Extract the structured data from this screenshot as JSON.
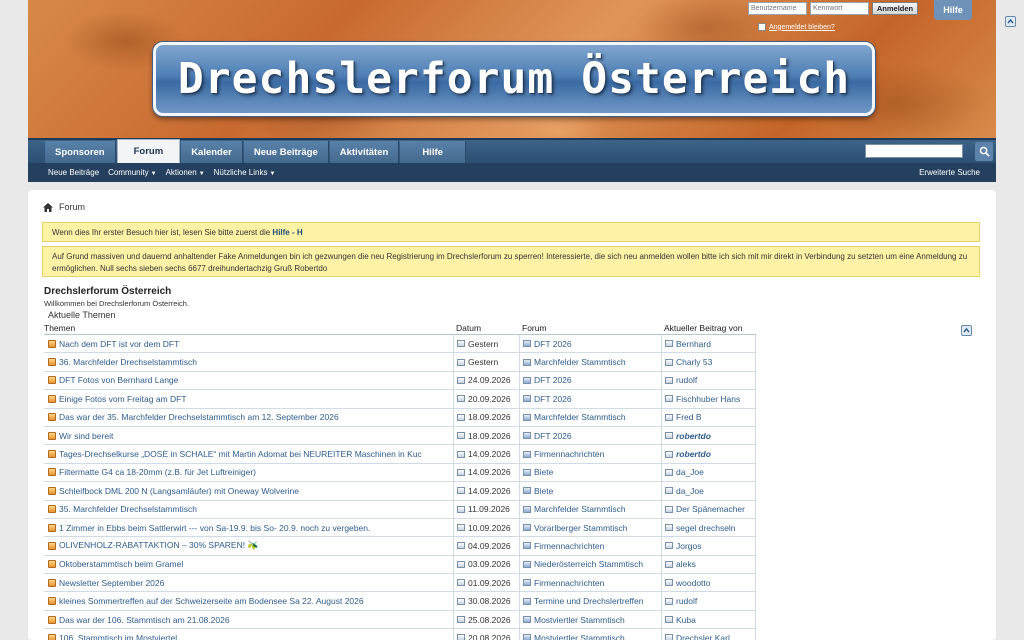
{
  "header": {
    "logo_text": "Drechslerforum Österreich",
    "username_placeholder": "Benutzername",
    "password_placeholder": "Kennwort",
    "login_label": "Anmelden",
    "help_label": "Hilfe",
    "remember_label": "Angemeldet bleiben?"
  },
  "nav": {
    "tabs": [
      "Sponsoren",
      "Forum",
      "Kalender",
      "Neue Beiträge",
      "Aktivitäten",
      "Hilfe"
    ],
    "active_tab": "Forum",
    "sub_items": [
      "Neue Beiträge",
      "Community",
      "Aktionen",
      "Nützliche Links"
    ],
    "advanced_search": "Erweiterte Suche"
  },
  "breadcrumb": {
    "label": "Forum"
  },
  "notices": {
    "first_visit_text": "Wenn dies Ihr erster Besuch hier ist, lesen Sie bitte zuerst die",
    "first_visit_link": "Hilfe - H",
    "registration_text": "Auf Grund massiven und dauernd anhaltender Fake Anmeldungen bin ich gezwungen die neu Registrierung im Drechslerforum zu sperren! Interessierte, die sich neu anmelden wollen bitte ich sich mit mir direkt in Verbindung zu setzten um eine Anmeldung zu ermöglichen. Null sechs sieben sechs 6677 dreihundertachzig Gruß Robertdo"
  },
  "forum": {
    "title": "Drechslerforum Österreich",
    "subtitle": "Willkommen bei Drechslerforum Österreich.",
    "topics_label": "Aktuelle Themen"
  },
  "threads": {
    "headers": {
      "topic": "Themen",
      "date": "Datum",
      "forum": "Forum",
      "last_post": "Aktueller Beitrag von"
    },
    "rows": [
      {
        "topic": "Nach dem DFT ist vor dem DFT",
        "date": "Gestern",
        "forum": "DFT 2026",
        "user": "Bernhard",
        "emph": false
      },
      {
        "topic": "36. Marchfelder Drechselstammtisch",
        "date": "Gestern",
        "forum": "Marchfelder Stammtisch",
        "user": "Charly 53",
        "emph": false
      },
      {
        "topic": "DFT Fotos von Bernhard Lange",
        "date": "24.09.2026",
        "forum": "DFT 2026",
        "user": "rudolf",
        "emph": false
      },
      {
        "topic": "Einige Fotos vom Freitag am DFT",
        "date": "20.09.2026",
        "forum": "DFT 2026",
        "user": "Fischhuber Hans",
        "emph": false
      },
      {
        "topic": "Das war der 35. Marchfelder Drechselstammtisch am 12. September 2026",
        "date": "18.09.2026",
        "forum": "Marchfelder Stammtisch",
        "user": "Fred B",
        "emph": false
      },
      {
        "topic": "Wir sind bereit",
        "date": "18.09.2026",
        "forum": "DFT 2026",
        "user": "robertdo",
        "emph": true
      },
      {
        "topic": "Tages-Drechselkurse „DOSE in SCHALE“ mit Martin Adomat bei NEUREITER Maschinen in Kuc",
        "date": "14.09.2026",
        "forum": "Firmennachrichten",
        "user": "robertdo",
        "emph": true
      },
      {
        "topic": "Filtermatte G4 ca 18-20mm (z.B. für Jet Luftreiniger)",
        "date": "14.09.2026",
        "forum": "Biete",
        "user": "da_Joe",
        "emph": false
      },
      {
        "topic": "Schleifbock DML 200 N (Langsamläufer) mit Oneway Wolverine",
        "date": "14.09.2026",
        "forum": "Biete",
        "user": "da_Joe",
        "emph": false
      },
      {
        "topic": "35. Marchfelder Drechselstammtisch",
        "date": "11.09.2026",
        "forum": "Marchfelder Stammtisch",
        "user": "Der Spänemacher",
        "emph": false
      },
      {
        "topic": "1 Zimmer in Ebbs beim Sattlerwirt --- von Sa-19.9. bis So- 20.9. noch zu vergeben.",
        "date": "10.09.2026",
        "forum": "Vorarlberger Stammtisch",
        "user": "segel drechseln",
        "emph": false
      },
      {
        "topic": "OLIVENHOLZ-RABATTAKTION – 30% SPAREN! 🫒",
        "date": "04.09.2026",
        "forum": "Firmennachrichten",
        "user": "Jorgos",
        "emph": false
      },
      {
        "topic": "Oktoberstammtisch beim Gramel",
        "date": "03.09.2026",
        "forum": "Niederösterreich Stammtisch",
        "user": "aleks",
        "emph": false
      },
      {
        "topic": "Newsletter September 2026",
        "date": "01.09.2026",
        "forum": "Firmennachrichten",
        "user": "woodotto",
        "emph": false
      },
      {
        "topic": "kleines Sommertreffen auf der Schweizerseite am Bodensee Sa 22. August 2026",
        "date": "30.08.2026",
        "forum": "Termine und Drechslertreffen",
        "user": "rudolf",
        "emph": false
      },
      {
        "topic": "Das war der 106. Stammtisch am 21.08.2026",
        "date": "25.08.2026",
        "forum": "Mostviertler Stammtisch",
        "user": "Kuba",
        "emph": false
      },
      {
        "topic": "106. Stammtisch im Mostviertel",
        "date": "20.08.2026",
        "forum": "Mostviertler Stammtisch",
        "user": "Drechsler Karl",
        "emph": false
      }
    ]
  }
}
